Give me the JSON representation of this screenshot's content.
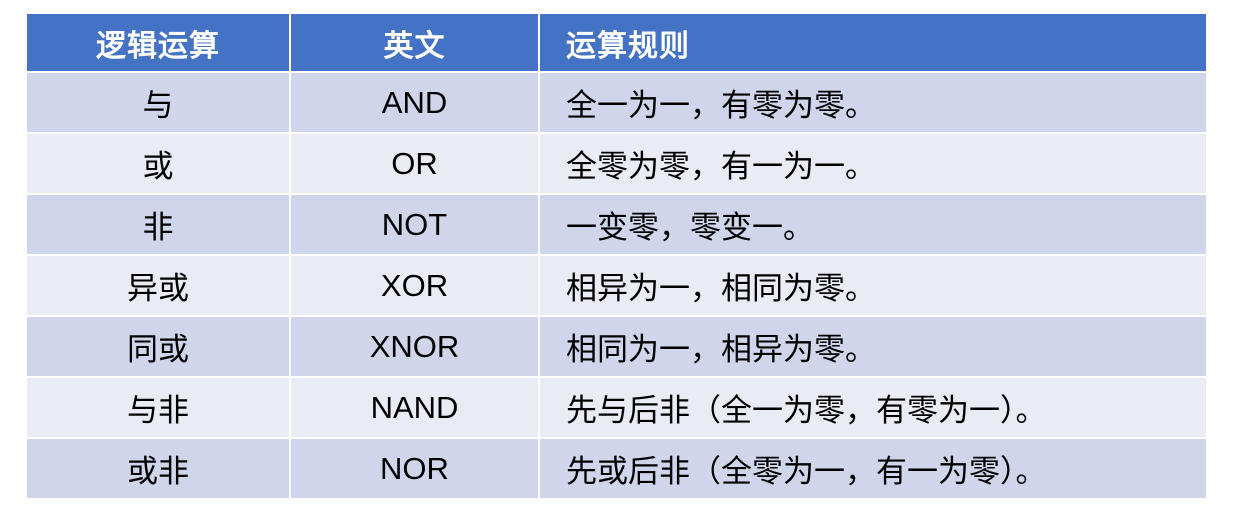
{
  "table": {
    "headers": [
      "逻辑运算",
      "英文",
      "运算规则"
    ],
    "rows": [
      {
        "op": "与",
        "en": "AND",
        "rule": "全一为一，有零为零。"
      },
      {
        "op": "或",
        "en": "OR",
        "rule": "全零为零，有一为一。"
      },
      {
        "op": "非",
        "en": "NOT",
        "rule": "一变零，零变一。"
      },
      {
        "op": "异或",
        "en": "XOR",
        "rule": "相异为一，相同为零。"
      },
      {
        "op": "同或",
        "en": "XNOR",
        "rule": "相同为一，相异为零。"
      },
      {
        "op": "与非",
        "en": "NAND",
        "rule": "先与后非（全一为零，有零为一）。"
      },
      {
        "op": "或非",
        "en": "NOR",
        "rule": "先或后非（全零为一，有一为零）。"
      }
    ],
    "colors": {
      "header_bg": "#4472c4",
      "row_dark": "#cfd5ea",
      "row_light": "#e9ebf5"
    }
  }
}
